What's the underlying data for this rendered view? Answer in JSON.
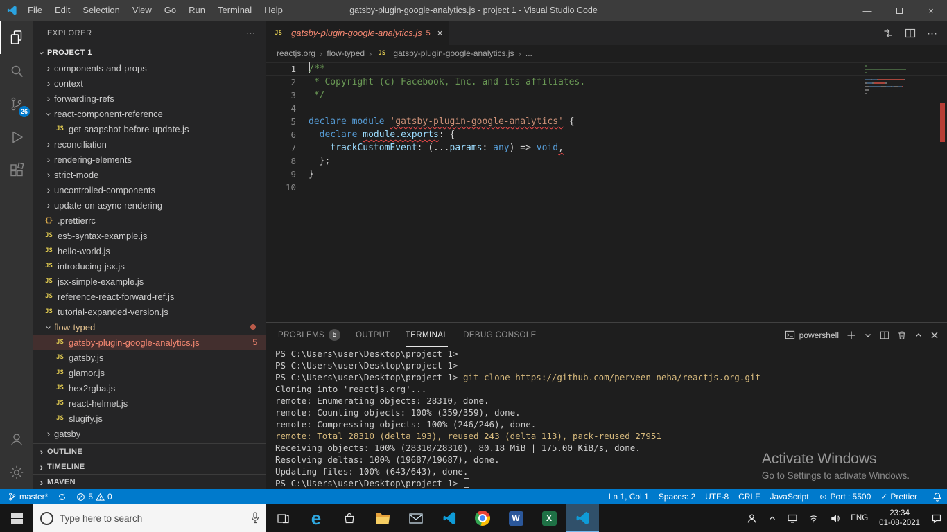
{
  "window": {
    "title": "gatsby-plugin-google-analytics.js - project 1 - Visual Studio Code",
    "menus": [
      "File",
      "Edit",
      "Selection",
      "View",
      "Go",
      "Run",
      "Terminal",
      "Help"
    ]
  },
  "activity_bar": {
    "source_control_badge": "26"
  },
  "icons": {
    "js_badge": "JS",
    "braces_badge": "{}"
  },
  "sidebar": {
    "header": "EXPLORER",
    "project": "PROJECT 1",
    "tree": [
      {
        "label": "components-and-props",
        "type": "folder",
        "depth": 1
      },
      {
        "label": "context",
        "type": "folder",
        "depth": 1
      },
      {
        "label": "forwarding-refs",
        "type": "folder",
        "depth": 1
      },
      {
        "label": "react-component-reference",
        "type": "folder",
        "depth": 1,
        "expanded": true
      },
      {
        "label": "get-snapshot-before-update.js",
        "type": "file",
        "icon": "js",
        "depth": 2
      },
      {
        "label": "reconciliation",
        "type": "folder",
        "depth": 1
      },
      {
        "label": "rendering-elements",
        "type": "folder",
        "depth": 1
      },
      {
        "label": "strict-mode",
        "type": "folder",
        "depth": 1
      },
      {
        "label": "uncontrolled-components",
        "type": "folder",
        "depth": 1
      },
      {
        "label": "update-on-async-rendering",
        "type": "folder",
        "depth": 1
      },
      {
        "label": ".prettierrc",
        "type": "file",
        "icon": "braces",
        "depth": 1
      },
      {
        "label": "es5-syntax-example.js",
        "type": "file",
        "icon": "js",
        "depth": 1
      },
      {
        "label": "hello-world.js",
        "type": "file",
        "icon": "js",
        "depth": 1
      },
      {
        "label": "introducing-jsx.js",
        "type": "file",
        "icon": "js",
        "depth": 1
      },
      {
        "label": "jsx-simple-example.js",
        "type": "file",
        "icon": "js",
        "depth": 1
      },
      {
        "label": "reference-react-forward-ref.js",
        "type": "file",
        "icon": "js",
        "depth": 1
      },
      {
        "label": "tutorial-expanded-version.js",
        "type": "file",
        "icon": "js",
        "depth": 1
      },
      {
        "label": "flow-typed",
        "type": "folder",
        "depth": 1,
        "expanded": true,
        "modified": true
      },
      {
        "label": "gatsby-plugin-google-analytics.js",
        "type": "file",
        "icon": "js",
        "depth": 2,
        "selected": true,
        "error": true,
        "badge": "5"
      },
      {
        "label": "gatsby.js",
        "type": "file",
        "icon": "js",
        "depth": 2
      },
      {
        "label": "glamor.js",
        "type": "file",
        "icon": "js",
        "depth": 2
      },
      {
        "label": "hex2rgba.js",
        "type": "file",
        "icon": "js",
        "depth": 2
      },
      {
        "label": "react-helmet.js",
        "type": "file",
        "icon": "js",
        "depth": 2
      },
      {
        "label": "slugify.js",
        "type": "file",
        "icon": "js",
        "depth": 2
      },
      {
        "label": "gatsby",
        "type": "folder",
        "depth": 1
      }
    ],
    "sections": [
      "OUTLINE",
      "TIMELINE",
      "MAVEN"
    ]
  },
  "editor": {
    "tab": {
      "label": "gatsby-plugin-google-analytics.js",
      "badge": "5"
    },
    "breadcrumbs": [
      "reactjs.org",
      "flow-typed",
      "gatsby-plugin-google-analytics.js",
      "..."
    ],
    "code": [
      {
        "n": 1,
        "current": true,
        "seg": [
          {
            "t": "/**",
            "c": "comment"
          }
        ]
      },
      {
        "n": 2,
        "seg": [
          {
            "t": " * Copyright (c) Facebook, Inc. and its affiliates.",
            "c": "comment"
          }
        ]
      },
      {
        "n": 3,
        "seg": [
          {
            "t": " */",
            "c": "comment"
          }
        ]
      },
      {
        "n": 4,
        "seg": []
      },
      {
        "n": 5,
        "seg": [
          {
            "t": "declare",
            "c": "kw"
          },
          {
            "t": " ",
            "c": "plain"
          },
          {
            "t": "module",
            "c": "kw"
          },
          {
            "t": " ",
            "c": "plain"
          },
          {
            "t": "'gatsby-plugin-google-analytics'",
            "c": "str sq"
          },
          {
            "t": " {",
            "c": "plain"
          }
        ]
      },
      {
        "n": 6,
        "seg": [
          {
            "t": "  ",
            "c": "plain"
          },
          {
            "t": "declare",
            "c": "kw"
          },
          {
            "t": " ",
            "c": "plain"
          },
          {
            "t": "module.exports",
            "c": "var sq"
          },
          {
            "t": ": {",
            "c": "plain"
          }
        ]
      },
      {
        "n": 7,
        "seg": [
          {
            "t": "    ",
            "c": "plain"
          },
          {
            "t": "trackCustomEvent",
            "c": "var"
          },
          {
            "t": ": (",
            "c": "plain"
          },
          {
            "t": "...",
            "c": "plain"
          },
          {
            "t": "params",
            "c": "var"
          },
          {
            "t": ": ",
            "c": "plain"
          },
          {
            "t": "any",
            "c": "kw"
          },
          {
            "t": ") ",
            "c": "plain"
          },
          {
            "t": "=> ",
            "c": "plain"
          },
          {
            "t": "void",
            "c": "kw"
          },
          {
            "t": ",",
            "c": "plain sq"
          }
        ]
      },
      {
        "n": 8,
        "seg": [
          {
            "t": "  };",
            "c": "plain"
          }
        ]
      },
      {
        "n": 9,
        "seg": [
          {
            "t": "}",
            "c": "plain"
          }
        ]
      },
      {
        "n": 10,
        "seg": []
      }
    ]
  },
  "panel": {
    "tabs": [
      {
        "label": "PROBLEMS",
        "badge": "5"
      },
      {
        "label": "OUTPUT"
      },
      {
        "label": "TERMINAL",
        "active": true
      },
      {
        "label": "DEBUG CONSOLE"
      }
    ],
    "shell": "powershell",
    "terminal": [
      [
        {
          "t": "PS C:\\Users\\user\\Desktop\\project 1>",
          "c": "plain"
        }
      ],
      [
        {
          "t": "PS C:\\Users\\user\\Desktop\\project 1>",
          "c": "plain"
        }
      ],
      [
        {
          "t": "PS C:\\Users\\user\\Desktop\\project 1> ",
          "c": "plain"
        },
        {
          "t": "git clone https://github.com/perveen-neha/reactjs.org.git",
          "c": "cmd"
        }
      ],
      [
        {
          "t": "Cloning into 'reactjs.org'...",
          "c": "plain"
        }
      ],
      [
        {
          "t": "remote: Enumerating objects: 28310, done.",
          "c": "plain"
        }
      ],
      [
        {
          "t": "remote: Counting objects: 100% (359/359), done.",
          "c": "plain"
        }
      ],
      [
        {
          "t": "remote: Compressing objects: 100% (246/246), done.",
          "c": "plain"
        }
      ],
      [
        {
          "t": "remote: Total 28310 (delta 193), reused 243 (delta 113), pack-reused 27951",
          "c": "hl"
        }
      ],
      [
        {
          "t": "Receiving objects: 100% (28310/28310), 80.18 MiB | 175.00 KiB/s, done.",
          "c": "plain"
        }
      ],
      [
        {
          "t": "Resolving deltas: 100% (19687/19687), done.",
          "c": "plain"
        }
      ],
      [
        {
          "t": "Updating files: 100% (643/643), done.",
          "c": "plain"
        }
      ],
      [
        {
          "t": "PS C:\\Users\\user\\Desktop\\project 1> ",
          "c": "plain"
        },
        {
          "t": "",
          "c": "cursor"
        }
      ]
    ]
  },
  "status_bar": {
    "branch": "master*",
    "errors": "5",
    "warnings": "0",
    "right": [
      {
        "id": "cursor-position",
        "label": "Ln 1, Col 1"
      },
      {
        "id": "indentation",
        "label": "Spaces: 2"
      },
      {
        "id": "encoding",
        "label": "UTF-8"
      },
      {
        "id": "eol",
        "label": "CRLF"
      },
      {
        "id": "language",
        "label": "JavaScript"
      },
      {
        "id": "port",
        "label": "Port : 5500",
        "icon": "broadcast"
      },
      {
        "id": "formatter",
        "label": "Prettier",
        "icon": "check"
      }
    ]
  },
  "watermark": {
    "title": "Activate Windows",
    "subtitle": "Go to Settings to activate Windows."
  },
  "taskbar": {
    "search_placeholder": "Type here to search",
    "apps": [
      {
        "id": "task-view"
      },
      {
        "id": "edge"
      },
      {
        "id": "store"
      },
      {
        "id": "file-explorer"
      },
      {
        "id": "mail"
      },
      {
        "id": "vscode"
      },
      {
        "id": "chrome"
      },
      {
        "id": "word"
      },
      {
        "id": "excel"
      },
      {
        "id": "vscode",
        "active": true
      }
    ],
    "icon_letters": {
      "edge": "e",
      "word": "W",
      "excel": "X"
    },
    "language": "ENG",
    "time": "23:34",
    "date": "01-08-2021"
  }
}
